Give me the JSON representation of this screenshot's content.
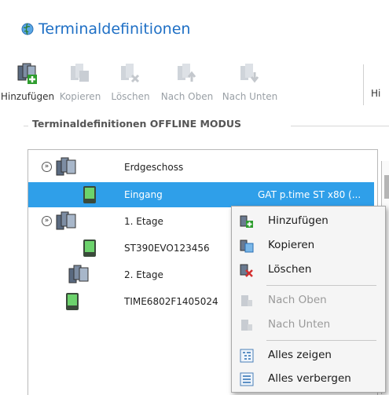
{
  "header": {
    "title": "Terminaldefinitionen"
  },
  "toolbar": {
    "add_label": "Hinzufügen",
    "copy_label": "Kopieren",
    "delete_label": "Löschen",
    "up_label": "Nach Oben",
    "down_label": "Nach Unten",
    "cut_label": "Hi"
  },
  "group": {
    "title": "Terminaldefinitionen OFFLINE MODUS"
  },
  "tree": {
    "rows": [
      {
        "name": "Erdgeschoss",
        "desc": ""
      },
      {
        "name": "Eingang",
        "desc": "GAT p.time ST x80 (..."
      },
      {
        "name": "1. Etage",
        "desc": ""
      },
      {
        "name": "ST390EVO123456",
        "desc": ""
      },
      {
        "name": "2. Etage",
        "desc": ""
      },
      {
        "name": "TIME6802F1405024",
        "desc": ""
      }
    ],
    "expander_glyph": "»"
  },
  "context_menu": {
    "items": [
      {
        "label": "Hinzufügen"
      },
      {
        "label": "Kopieren"
      },
      {
        "label": "Löschen"
      },
      {
        "label": "Nach Oben"
      },
      {
        "label": "Nach Unten"
      },
      {
        "label": "Alles zeigen"
      },
      {
        "label": "Alles verbergen"
      }
    ]
  },
  "colors": {
    "accent": "#1e6fc5",
    "selection": "#2f9fe9"
  }
}
